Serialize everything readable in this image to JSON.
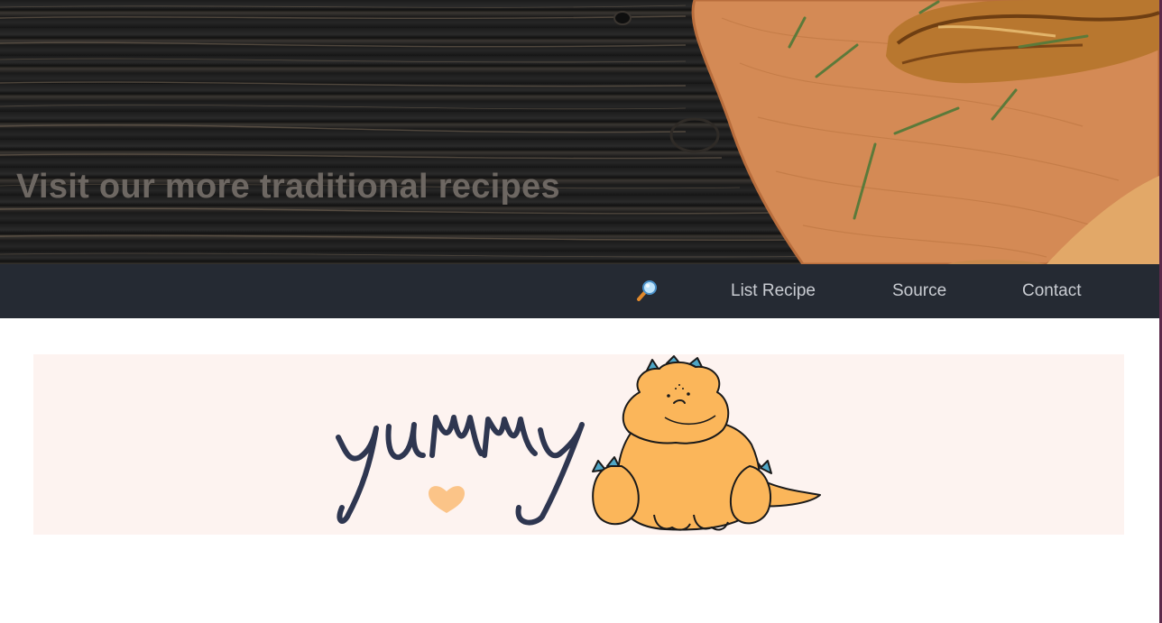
{
  "hero": {
    "title": "Visit our more traditional recipes"
  },
  "nav": {
    "search_icon": "magnifier-icon",
    "items": [
      {
        "label": "List Recipe"
      },
      {
        "label": "Source"
      },
      {
        "label": "Contact"
      }
    ]
  },
  "banner": {
    "text": "yummy",
    "image": "yummy-dinosaur-illustration"
  },
  "colors": {
    "nav_bg": "#252a33",
    "nav_text": "#c9ccd2",
    "banner_bg": "#fdf3f0",
    "dino": "#fbb65a",
    "lettering": "#2e3650"
  }
}
